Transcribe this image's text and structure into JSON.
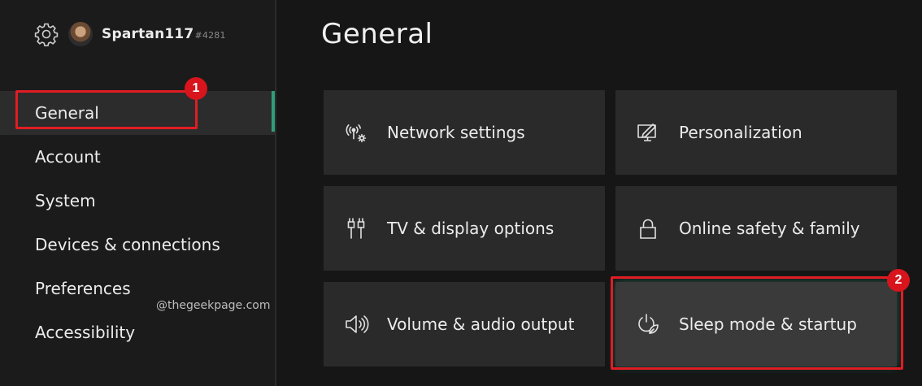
{
  "profile": {
    "gamertag": "Spartan117",
    "gamertag_suffix": "#4281"
  },
  "nav": {
    "items": [
      {
        "label": "General"
      },
      {
        "label": "Account"
      },
      {
        "label": "System"
      },
      {
        "label": "Devices & connections"
      },
      {
        "label": "Preferences"
      },
      {
        "label": "Accessibility"
      }
    ]
  },
  "main": {
    "title": "General",
    "tiles": [
      {
        "label": "Network settings",
        "icon": "network-icon"
      },
      {
        "label": "Personalization",
        "icon": "personalization-icon"
      },
      {
        "label": "TV & display options",
        "icon": "tv-display-icon"
      },
      {
        "label": "Online safety & family",
        "icon": "lock-icon"
      },
      {
        "label": "Volume & audio output",
        "icon": "speaker-icon"
      },
      {
        "label": "Sleep mode & startup",
        "icon": "power-leaf-icon"
      }
    ]
  },
  "annotations": {
    "badge_1": "1",
    "badge_2": "2",
    "watermark": "@thegeekpage.com"
  },
  "colors": {
    "accent": "#2e9e7a",
    "highlight": "#e11d24",
    "tile": "#2a2a2a"
  }
}
